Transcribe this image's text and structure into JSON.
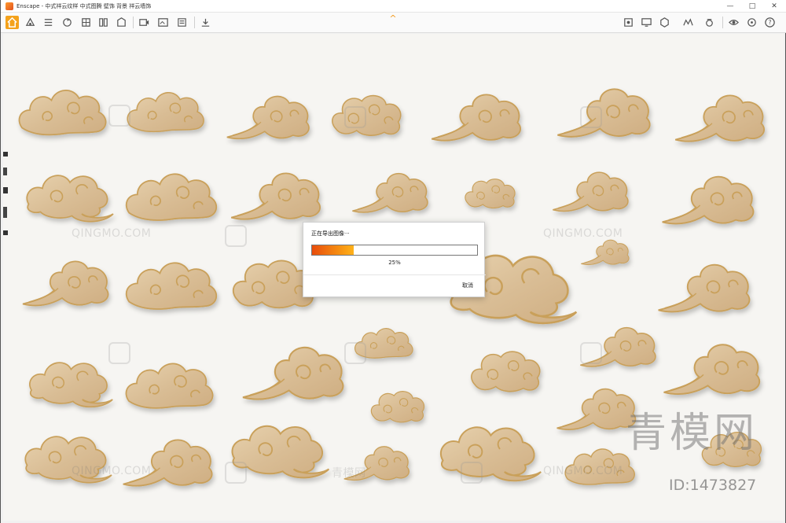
{
  "window": {
    "title": "Enscape - 中式祥云纹样 中式图腾 壁饰 背景 祥云墙饰",
    "buttons": {
      "minimize": "—",
      "maximize": "□",
      "close": "✕"
    }
  },
  "toolbar": {
    "left_icons": [
      "home-icon",
      "asset-library-icon",
      "settings-list-icon",
      "sync-icon",
      "material-icon",
      "book-icon",
      "building-icon",
      "video-icon",
      "screenshot-icon",
      "batch-render-icon",
      "capture-icon",
      "panorama-icon",
      "export-icon"
    ],
    "right_icons": [
      "view-management-icon",
      "display-icon",
      "render-mode-icon",
      "atmosphere-icon",
      "capture-settings-icon",
      "visual-settings-icon",
      "feedback-icon",
      "help-icon"
    ],
    "collapse_glyph": "^",
    "help_glyph": "?"
  },
  "watermarks": {
    "site_text": "QINGMO.COM",
    "site_cn": "青模网",
    "big_text": "青模网",
    "id_text": "ID:1473827"
  },
  "dialog": {
    "title": "正在导出图像···",
    "progress": 0.25,
    "progress_text": "25%",
    "cancel_label": "取消"
  },
  "colors": {
    "accent": "#f39a1c",
    "progress_start": "#e84c0c",
    "progress_end": "#ffb21a",
    "wood": "#dcc19d",
    "gold": "#c9a05a",
    "wall": "#f6f5f2"
  }
}
